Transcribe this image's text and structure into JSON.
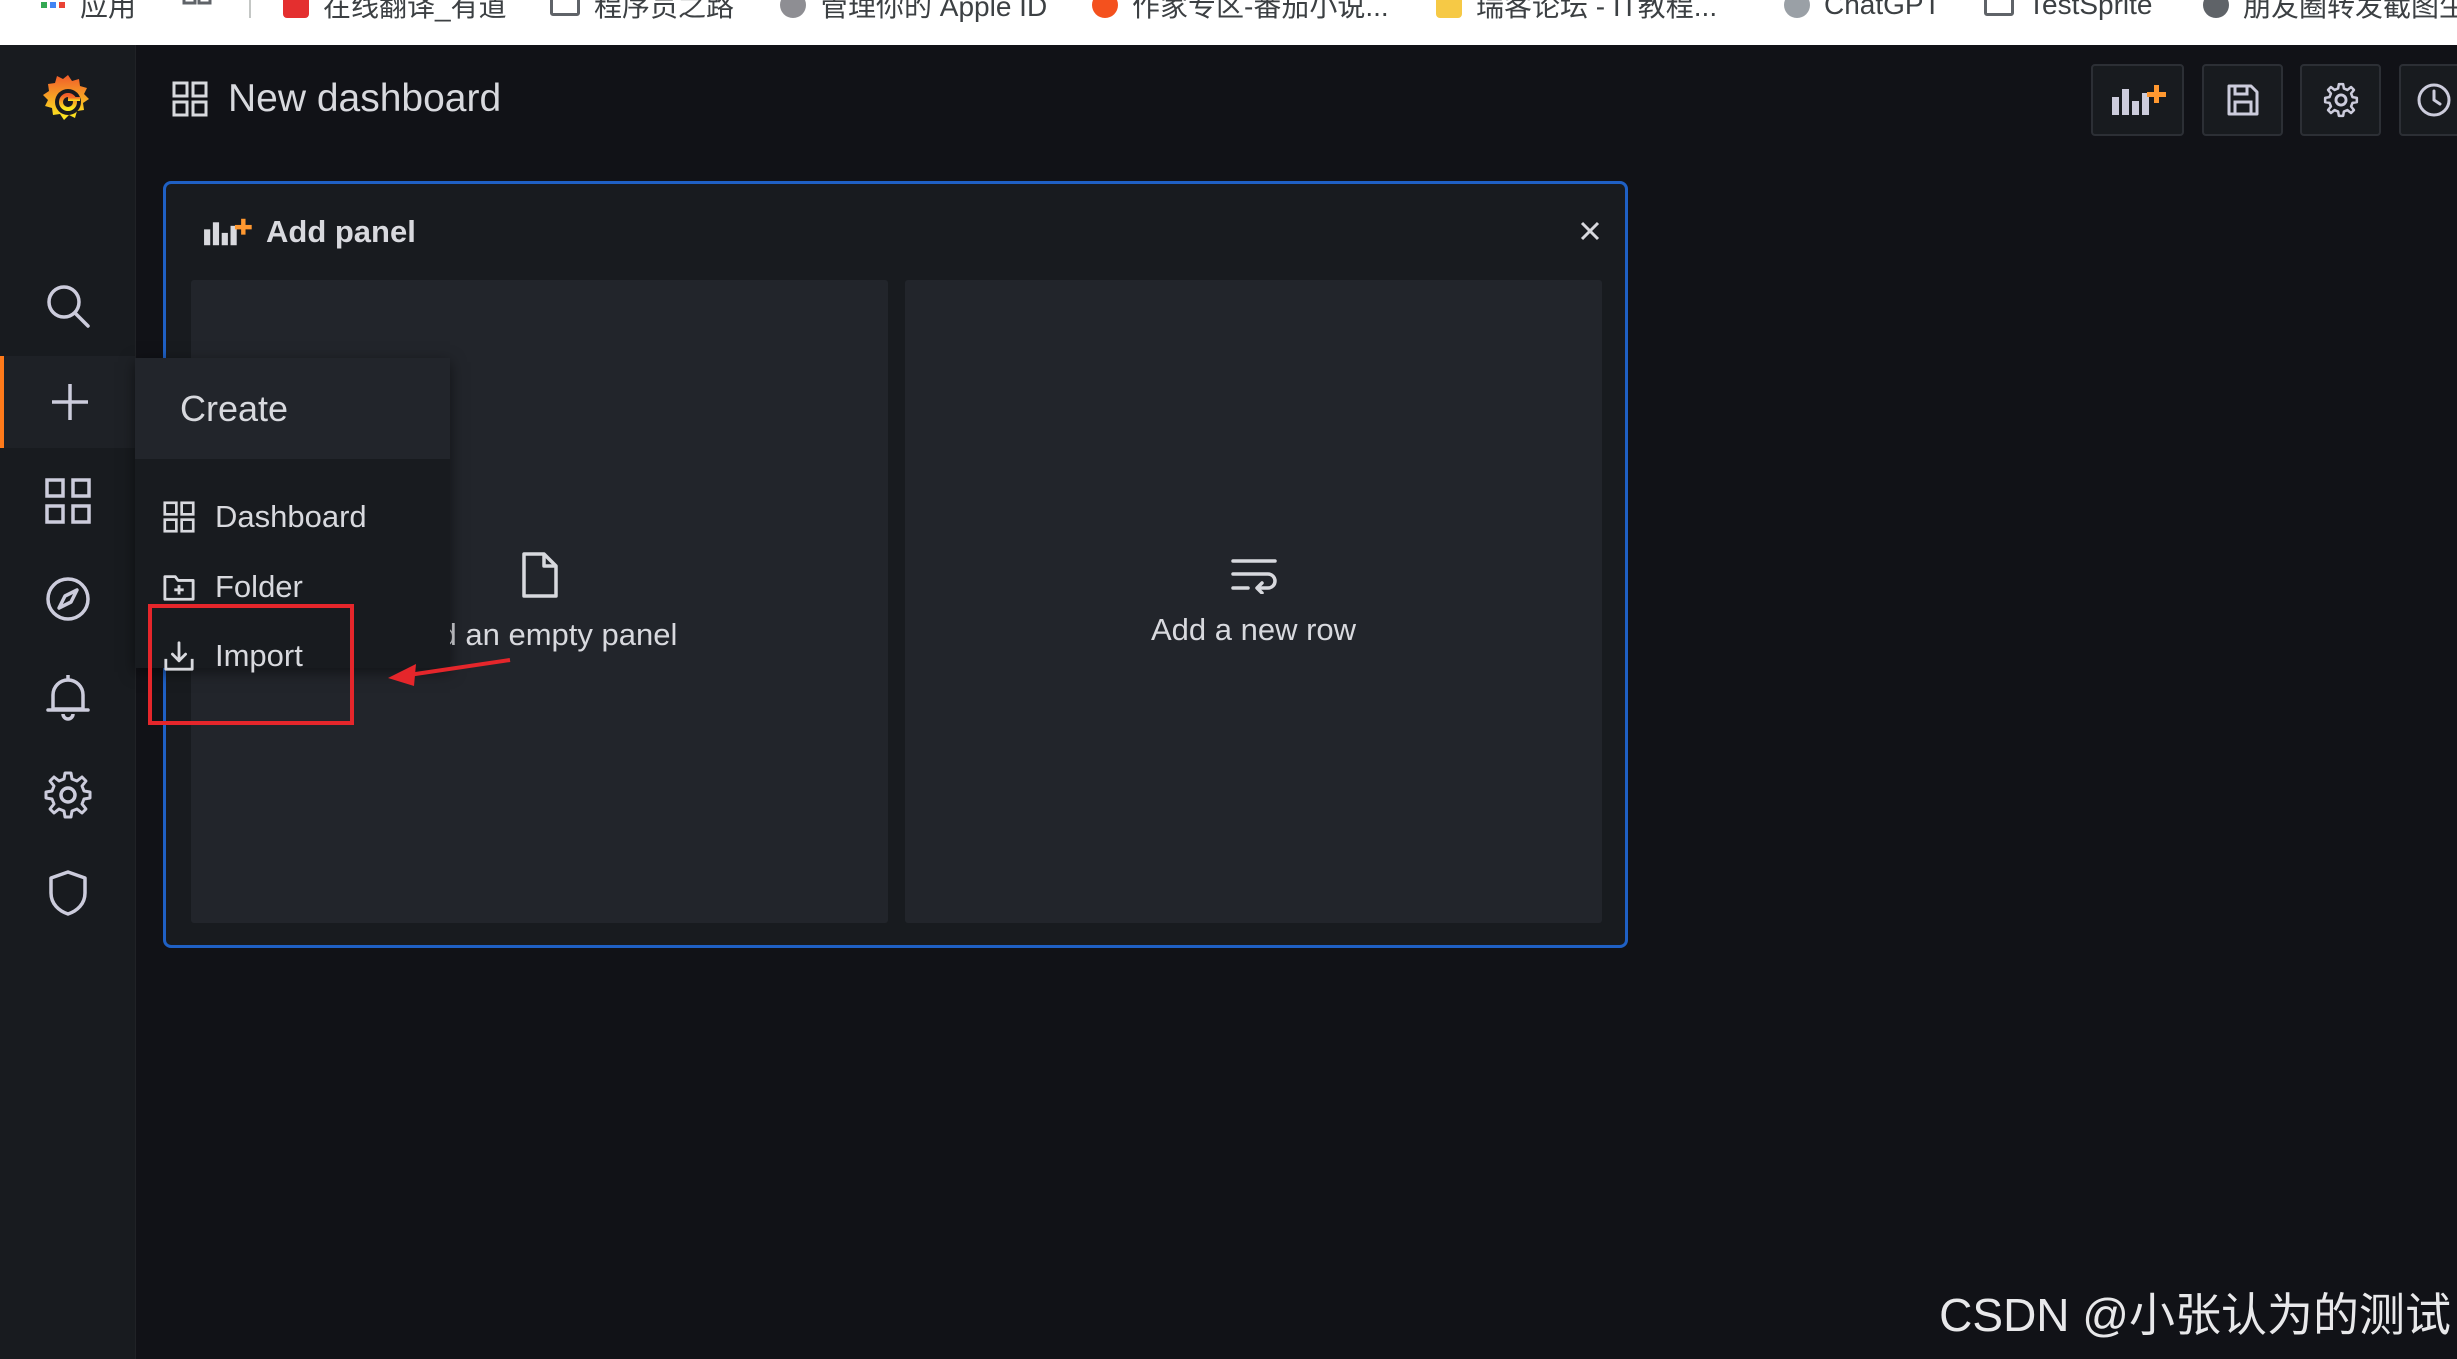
{
  "bookmarks": [
    {
      "label": "应用",
      "icon": "apps-grid-icon"
    },
    {
      "label": "",
      "icon": "grid-icon"
    },
    {
      "label": "在线翻译_有道",
      "icon": "youdao-icon"
    },
    {
      "label": "程序员之路",
      "icon": "folder-icon"
    },
    {
      "label": "管理你的 Apple ID",
      "icon": "apple-icon"
    },
    {
      "label": "作家专区-番茄小说...",
      "icon": "tomato-icon"
    },
    {
      "label": "瑞客论坛 - IT教程...",
      "icon": "forum-icon"
    },
    {
      "label": "ChatGPT",
      "icon": "openai-icon"
    },
    {
      "label": "TestSprite",
      "icon": "folder-icon"
    },
    {
      "label": "朋友圈转发截图生",
      "icon": "globe-icon"
    }
  ],
  "sidemenu": {
    "logo": "grafana-logo",
    "items": [
      {
        "name": "search",
        "icon": "search-icon"
      },
      {
        "name": "create",
        "icon": "plus-icon",
        "active": true
      },
      {
        "name": "dashboards",
        "icon": "apps-icon"
      },
      {
        "name": "explore",
        "icon": "compass-icon"
      },
      {
        "name": "alerting",
        "icon": "bell-icon"
      },
      {
        "name": "configuration",
        "icon": "gear-icon"
      },
      {
        "name": "server-admin",
        "icon": "shield-icon"
      }
    ]
  },
  "topnav": {
    "title": "New dashboard",
    "buttons": [
      "add-panel-icon",
      "save-icon",
      "gear-icon",
      "clock-icon"
    ]
  },
  "add_panel": {
    "title": "Add panel",
    "empty_panel_label": "Add an empty panel",
    "new_row_label": "Add a new row"
  },
  "create_menu": {
    "header": "Create",
    "items": [
      {
        "label": "Dashboard",
        "icon": "apps-icon"
      },
      {
        "label": "Folder",
        "icon": "folder-plus-icon"
      },
      {
        "label": "Import",
        "icon": "import-icon"
      }
    ]
  },
  "colors": {
    "background": "#111217",
    "panel": "#181b1f",
    "accent": "#ff7a1a",
    "panel_border": "#1f60c4",
    "annotation": "#e5262b"
  },
  "watermark": "CSDN @小张认为的测试"
}
